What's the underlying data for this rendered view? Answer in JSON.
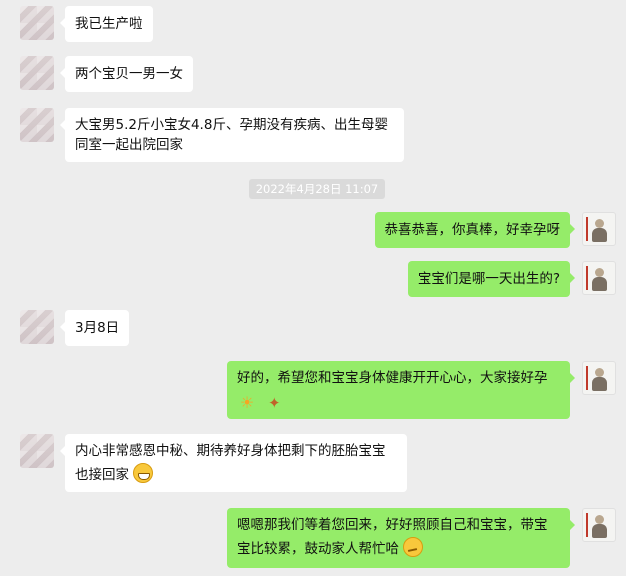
{
  "timestamp": "2022年4月28日 11:07",
  "messages": [
    {
      "text": "我已生产啦"
    },
    {
      "text": "两个宝贝一男一女"
    },
    {
      "line1": "大宝男5.2斤小宝女4.8斤、孕期没有疾病、出生母婴",
      "line2": "同室一起出院回家"
    },
    {
      "text": "恭喜恭喜，你真棒，好幸孕呀"
    },
    {
      "text": "宝宝们是哪一天出生的?"
    },
    {
      "text": "3月8日"
    },
    {
      "line1": "好的，希望您和宝宝身体健康开开心心，大家接好孕"
    },
    {
      "line1": "内心非常感恩中秘、期待养好身体把剩下的胚胎宝宝",
      "line2": "也接回家"
    },
    {
      "line1": "嗯嗯那我们等着您回来，好好照顾自己和宝宝，带宝",
      "line2": "宝比较累，鼓动家人帮忙哈"
    }
  ],
  "icons": {
    "sun": "sun-emoji",
    "party": "party-popper-emoji",
    "grin": "grinning-emoji",
    "think": "thinking-emoji"
  }
}
